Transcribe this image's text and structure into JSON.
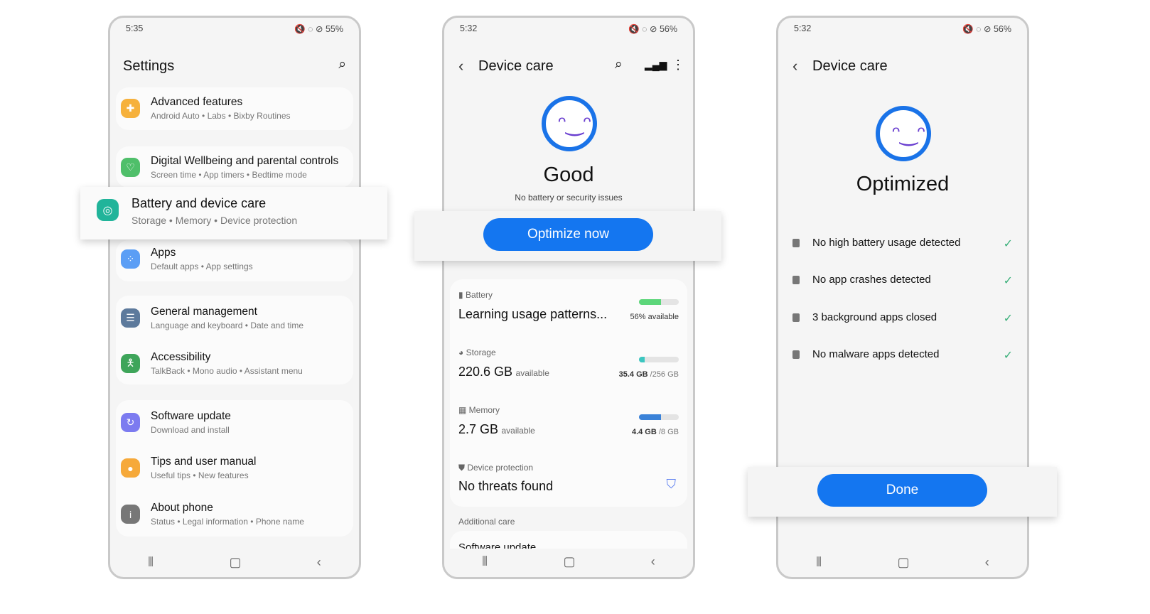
{
  "screen1": {
    "status": {
      "time": "5:35",
      "battery": "55%"
    },
    "title": "Settings",
    "items": [
      {
        "title": "Advanced features",
        "subtitle": "Android Auto  •  Labs  •  Bixby Routines",
        "color": "#f6b13c"
      },
      {
        "title": "Digital Wellbeing and parental controls",
        "subtitle": "Screen time  •  App timers  •  Bedtime mode",
        "color": "#4fbf6a"
      },
      {
        "title": "Battery and device care",
        "subtitle": "Storage  •  Memory  •  Device protection",
        "color": "#21b49a"
      },
      {
        "title": "Apps",
        "subtitle": "Default apps  •  App settings",
        "color": "#5b9ef5"
      },
      {
        "title": "General management",
        "subtitle": "Language and keyboard  •  Date and time",
        "color": "#5d7a9c"
      },
      {
        "title": "Accessibility",
        "subtitle": "TalkBack  •  Mono audio  •  Assistant menu",
        "color": "#3ea55a"
      },
      {
        "title": "Software update",
        "subtitle": "Download and install",
        "color": "#7c7bf0"
      },
      {
        "title": "Tips and user manual",
        "subtitle": "Useful tips  •  New features",
        "color": "#f6a93a"
      },
      {
        "title": "About phone",
        "subtitle": "Status  •  Legal information  •  Phone name",
        "color": "#777777"
      }
    ]
  },
  "screen2": {
    "status": {
      "time": "5:32",
      "battery": "56%"
    },
    "title": "Device care",
    "state": "Good",
    "state_sub": "No battery or security issues",
    "button": "Optimize now",
    "battery": {
      "label": "Battery",
      "value": "Learning usage patterns...",
      "detail": "56% available",
      "level": 0.56,
      "color": "#5cd67a"
    },
    "storage": {
      "label": "Storage",
      "value": "220.6 GB",
      "unit": "available",
      "used": "35.4 GB",
      "total": "/256 GB",
      "level": 0.14,
      "color": "#3cc6c0"
    },
    "memory": {
      "label": "Memory",
      "value": "2.7 GB",
      "unit": "available",
      "used": "4.4 GB",
      "total": "/8 GB",
      "level": 0.55,
      "color": "#3a82d8"
    },
    "protection": {
      "label": "Device protection",
      "value": "No threats found"
    },
    "additional": "Additional care",
    "next": "Software update"
  },
  "screen3": {
    "status": {
      "time": "5:32",
      "battery": "56%"
    },
    "title": "Device care",
    "state": "Optimized",
    "results": [
      "No high battery usage detected",
      "No app crashes detected",
      "3 background apps closed",
      "No malware apps detected"
    ],
    "button": "Done"
  },
  "accent": "#1476f0"
}
